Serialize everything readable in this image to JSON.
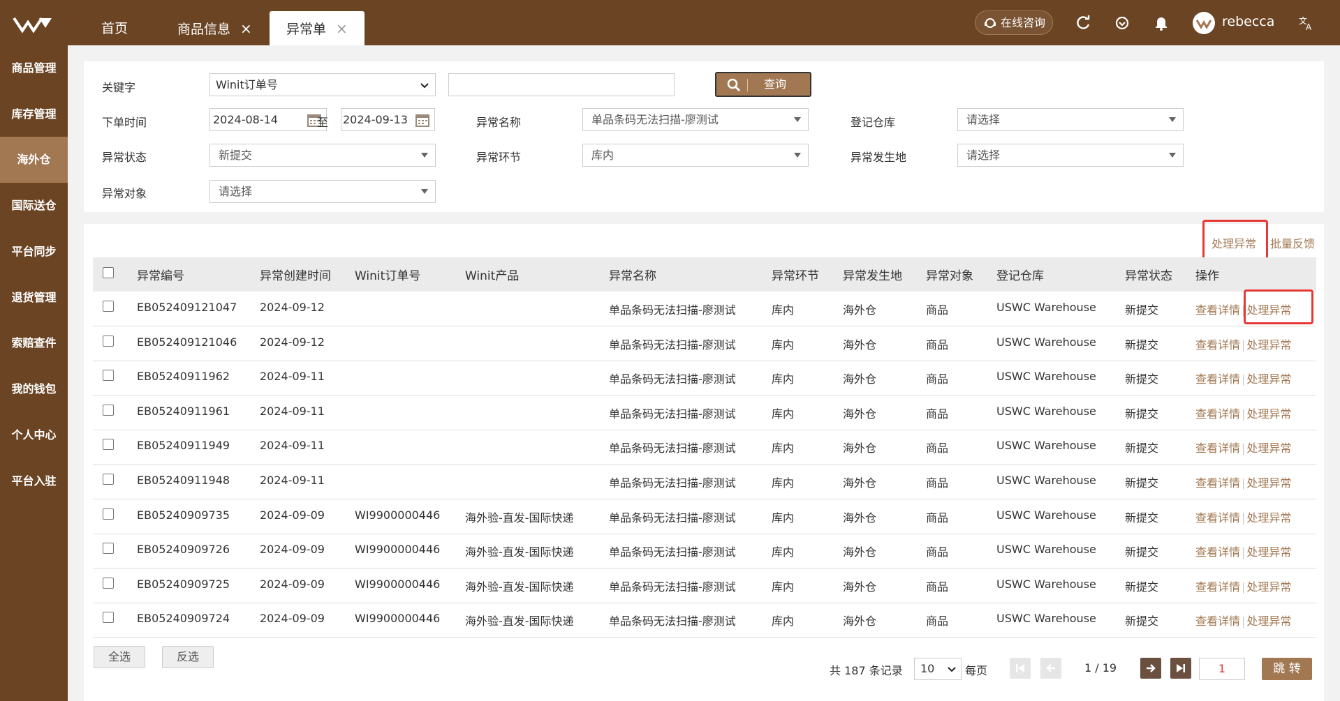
{
  "header": {
    "tabs": [
      {
        "label": "首页"
      },
      {
        "label": "商品信息"
      },
      {
        "label": "异常单"
      }
    ],
    "consult_label": "在线咨询",
    "username": "rebecca"
  },
  "sidebar": {
    "items": [
      {
        "label": "商品管理"
      },
      {
        "label": "库存管理"
      },
      {
        "label": "海外仓"
      },
      {
        "label": "国际送仓"
      },
      {
        "label": "平台同步"
      },
      {
        "label": "退货管理"
      },
      {
        "label": "索赔查件"
      },
      {
        "label": "我的钱包"
      },
      {
        "label": "个人中心"
      },
      {
        "label": "平台入驻"
      }
    ]
  },
  "filters": {
    "keyword_label": "关键字",
    "keyword_type": "Winit订单号",
    "keyword_value": "",
    "search_label": "查询",
    "order_time_label": "下单时间",
    "date_from": "2024-08-14",
    "date_to_sep": "至",
    "date_to": "2024-09-13",
    "exc_name_label": "异常名称",
    "exc_name_value": "单品条码无法扫描-廖测试",
    "warehouse_label": "登记仓库",
    "warehouse_value": "请选择",
    "status_label": "异常状态",
    "status_value": "新提交",
    "stage_label": "异常环节",
    "stage_value": "库内",
    "origin_label": "异常发生地",
    "origin_value": "请选择",
    "object_label": "异常对象",
    "object_value": "请选择"
  },
  "actions": {
    "handle_label": "处理异常",
    "batch_label": "批量反馈"
  },
  "table": {
    "headers": [
      "异常编号",
      "异常创建时间",
      "Winit订单号",
      "Winit产品",
      "异常名称",
      "异常环节",
      "异常发生地",
      "异常对象",
      "登记仓库",
      "异常状态",
      "操作"
    ],
    "view_label": "查看详情",
    "handle_label": "处理异常",
    "rows": [
      {
        "id": "EB052409121047",
        "time": "2024-09-12",
        "order": "",
        "product": "",
        "name": "单品条码无法扫描-廖测试",
        "stage": "库内",
        "origin": "海外仓",
        "object": "商品",
        "warehouse": "USWC Warehouse",
        "status": "新提交"
      },
      {
        "id": "EB052409121046",
        "time": "2024-09-12",
        "order": "",
        "product": "",
        "name": "单品条码无法扫描-廖测试",
        "stage": "库内",
        "origin": "海外仓",
        "object": "商品",
        "warehouse": "USWC Warehouse",
        "status": "新提交"
      },
      {
        "id": "EB05240911962",
        "time": "2024-09-11",
        "order": "",
        "product": "",
        "name": "单品条码无法扫描-廖测试",
        "stage": "库内",
        "origin": "海外仓",
        "object": "商品",
        "warehouse": "USWC Warehouse",
        "status": "新提交"
      },
      {
        "id": "EB05240911961",
        "time": "2024-09-11",
        "order": "",
        "product": "",
        "name": "单品条码无法扫描-廖测试",
        "stage": "库内",
        "origin": "海外仓",
        "object": "商品",
        "warehouse": "USWC Warehouse",
        "status": "新提交"
      },
      {
        "id": "EB05240911949",
        "time": "2024-09-11",
        "order": "",
        "product": "",
        "name": "单品条码无法扫描-廖测试",
        "stage": "库内",
        "origin": "海外仓",
        "object": "商品",
        "warehouse": "USWC Warehouse",
        "status": "新提交"
      },
      {
        "id": "EB05240911948",
        "time": "2024-09-11",
        "order": "",
        "product": "",
        "name": "单品条码无法扫描-廖测试",
        "stage": "库内",
        "origin": "海外仓",
        "object": "商品",
        "warehouse": "USWC Warehouse",
        "status": "新提交"
      },
      {
        "id": "EB05240909735",
        "time": "2024-09-09",
        "order": "WI9900000446",
        "product": "海外验-直发-国际快递",
        "name": "单品条码无法扫描-廖测试",
        "stage": "库内",
        "origin": "海外仓",
        "object": "商品",
        "warehouse": "USWC Warehouse",
        "status": "新提交"
      },
      {
        "id": "EB05240909726",
        "time": "2024-09-09",
        "order": "WI9900000446",
        "product": "海外验-直发-国际快递",
        "name": "单品条码无法扫描-廖测试",
        "stage": "库内",
        "origin": "海外仓",
        "object": "商品",
        "warehouse": "USWC Warehouse",
        "status": "新提交"
      },
      {
        "id": "EB05240909725",
        "time": "2024-09-09",
        "order": "WI9900000446",
        "product": "海外验-直发-国际快递",
        "name": "单品条码无法扫描-廖测试",
        "stage": "库内",
        "origin": "海外仓",
        "object": "商品",
        "warehouse": "USWC Warehouse",
        "status": "新提交"
      },
      {
        "id": "EB05240909724",
        "time": "2024-09-09",
        "order": "WI9900000446",
        "product": "海外验-直发-国际快递",
        "name": "单品条码无法扫描-廖测试",
        "stage": "库内",
        "origin": "海外仓",
        "object": "商品",
        "warehouse": "USWC Warehouse",
        "status": "新提交"
      }
    ]
  },
  "footer": {
    "select_all": "全选",
    "invert": "反选",
    "total_text": "共 187 条记录",
    "page_size": "10",
    "per_page": "每页",
    "page_info": "1 / 19",
    "jump_value": "1",
    "jump_label": "跳 转"
  },
  "colors": {
    "brand_dark": "#6b4423",
    "brand_accent": "#a27852",
    "highlight": "#e53935"
  }
}
